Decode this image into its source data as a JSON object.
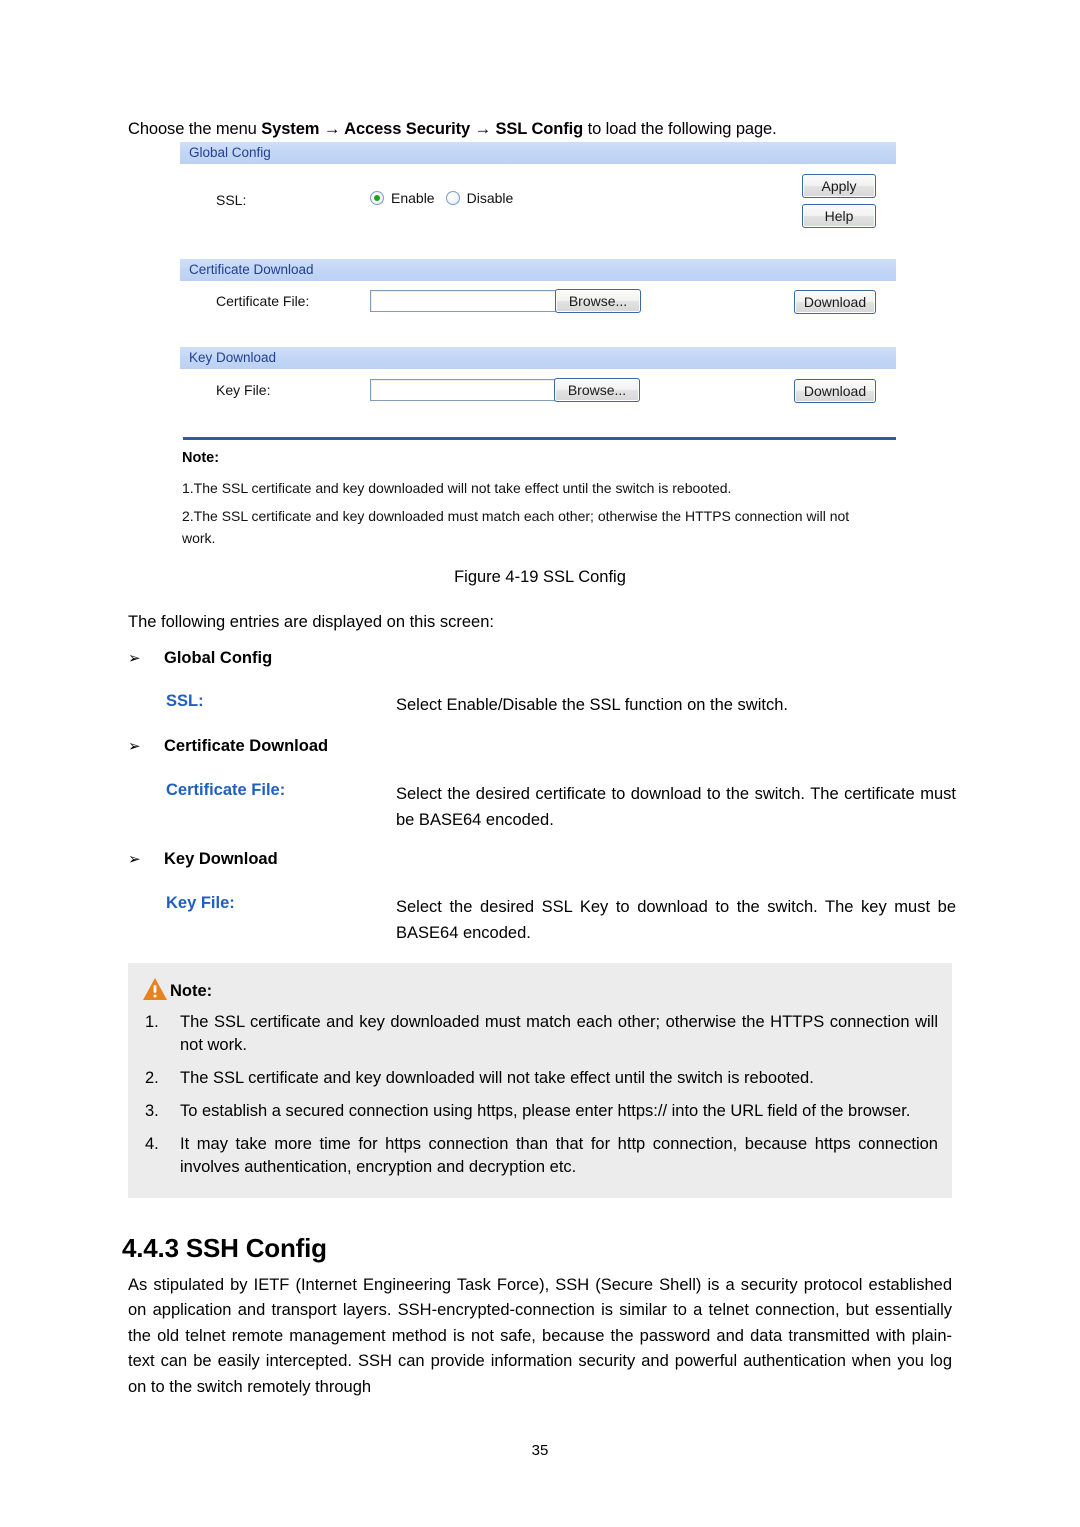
{
  "intro": {
    "prefix": "Choose the menu ",
    "menu1": "System",
    "arrow1": " → ",
    "menu2": "Access Security",
    "arrow2": " → ",
    "menu3": "SSL Config",
    "suffix": " to load the following page."
  },
  "screenshot": {
    "sections": {
      "global": {
        "bar_title": "Global Config",
        "ssl_label": "SSL:",
        "radio_enable": "Enable",
        "radio_disable": "Disable",
        "selected": "Enable",
        "apply_label": "Apply",
        "help_label": "Help"
      },
      "certificate": {
        "bar_title": "Certificate Download",
        "file_label": "Certificate File:",
        "file_value": "",
        "browse_label": "Browse...",
        "download_label": "Download"
      },
      "key": {
        "bar_title": "Key Download",
        "file_label": "Key File:",
        "file_value": "",
        "browse_label": "Browse...",
        "download_label": "Download"
      }
    },
    "note": {
      "title": "Note:",
      "lines": [
        "1.The SSL certificate and key downloaded will not take effect until the switch is rebooted.",
        "2.The SSL certificate and key downloaded must match each other; otherwise the HTTPS connection will not work."
      ]
    },
    "colors": {
      "bar_bg": "#c3d7f5",
      "bar_text": "#23408e",
      "rule": "#2d5ca6",
      "radio_dot": "#22a022",
      "button_border": "#3a67a5"
    }
  },
  "figure_caption": "Figure 4-19 SSL Config",
  "following_entries": "The following entries are displayed on this screen:",
  "entries": [
    {
      "arrow": "➢",
      "heading": "Global Config",
      "term": "SSL:",
      "description": "Select Enable/Disable the SSL function on the switch."
    },
    {
      "arrow": "➢",
      "heading": "Certificate Download",
      "term": "Certificate File:",
      "description": "Select the desired certificate to download to the switch. The certificate must be BASE64 encoded."
    },
    {
      "arrow": "➢",
      "heading": "Key Download",
      "term": "Key File:",
      "description": "Select the desired SSL Key to download to the switch. The key must be BASE64 encoded."
    }
  ],
  "notebox": {
    "icon": "warning-triangle-icon",
    "title": "Note:",
    "items": [
      {
        "num": "1.",
        "text": "The SSL certificate and key downloaded must match each other; otherwise the HTTPS connection will not work."
      },
      {
        "num": "2.",
        "text": "The SSL certificate and key downloaded will not take effect until the switch is rebooted."
      },
      {
        "num": "3.",
        "text": "To establish a secured connection using https, please enter https:// into the URL field of the browser."
      },
      {
        "num": "4.",
        "text": "It may take more time for https connection than that for http connection, because https connection involves authentication, encryption and decryption etc."
      }
    ]
  },
  "section": {
    "heading": "4.4.3 SSH Config",
    "body": "As stipulated by IETF (Internet Engineering Task Force), SSH (Secure Shell) is a security protocol established on application and transport layers. SSH-encrypted-connection is similar to a telnet connection, but essentially the old telnet remote management method is not safe, because the password and data transmitted with plain-text can be easily intercepted. SSH can provide information security and powerful authentication when you log on to the switch remotely through"
  },
  "page_number": "35"
}
